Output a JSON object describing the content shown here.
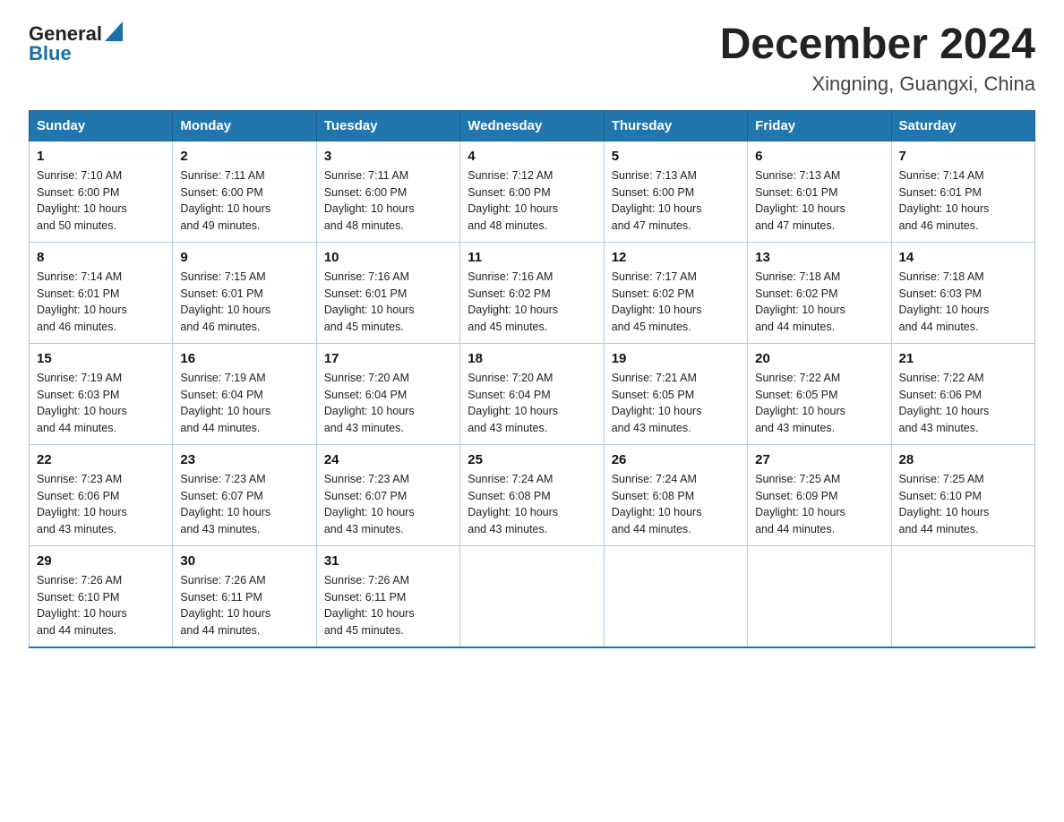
{
  "logo": {
    "general": "General",
    "triangle": "▶",
    "blue": "Blue"
  },
  "title": "December 2024",
  "location": "Xingning, Guangxi, China",
  "weekdays": [
    "Sunday",
    "Monday",
    "Tuesday",
    "Wednesday",
    "Thursday",
    "Friday",
    "Saturday"
  ],
  "weeks": [
    [
      {
        "day": "1",
        "sunrise": "7:10 AM",
        "sunset": "6:00 PM",
        "daylight": "10 hours and 50 minutes."
      },
      {
        "day": "2",
        "sunrise": "7:11 AM",
        "sunset": "6:00 PM",
        "daylight": "10 hours and 49 minutes."
      },
      {
        "day": "3",
        "sunrise": "7:11 AM",
        "sunset": "6:00 PM",
        "daylight": "10 hours and 48 minutes."
      },
      {
        "day": "4",
        "sunrise": "7:12 AM",
        "sunset": "6:00 PM",
        "daylight": "10 hours and 48 minutes."
      },
      {
        "day": "5",
        "sunrise": "7:13 AM",
        "sunset": "6:00 PM",
        "daylight": "10 hours and 47 minutes."
      },
      {
        "day": "6",
        "sunrise": "7:13 AM",
        "sunset": "6:01 PM",
        "daylight": "10 hours and 47 minutes."
      },
      {
        "day": "7",
        "sunrise": "7:14 AM",
        "sunset": "6:01 PM",
        "daylight": "10 hours and 46 minutes."
      }
    ],
    [
      {
        "day": "8",
        "sunrise": "7:14 AM",
        "sunset": "6:01 PM",
        "daylight": "10 hours and 46 minutes."
      },
      {
        "day": "9",
        "sunrise": "7:15 AM",
        "sunset": "6:01 PM",
        "daylight": "10 hours and 46 minutes."
      },
      {
        "day": "10",
        "sunrise": "7:16 AM",
        "sunset": "6:01 PM",
        "daylight": "10 hours and 45 minutes."
      },
      {
        "day": "11",
        "sunrise": "7:16 AM",
        "sunset": "6:02 PM",
        "daylight": "10 hours and 45 minutes."
      },
      {
        "day": "12",
        "sunrise": "7:17 AM",
        "sunset": "6:02 PM",
        "daylight": "10 hours and 45 minutes."
      },
      {
        "day": "13",
        "sunrise": "7:18 AM",
        "sunset": "6:02 PM",
        "daylight": "10 hours and 44 minutes."
      },
      {
        "day": "14",
        "sunrise": "7:18 AM",
        "sunset": "6:03 PM",
        "daylight": "10 hours and 44 minutes."
      }
    ],
    [
      {
        "day": "15",
        "sunrise": "7:19 AM",
        "sunset": "6:03 PM",
        "daylight": "10 hours and 44 minutes."
      },
      {
        "day": "16",
        "sunrise": "7:19 AM",
        "sunset": "6:04 PM",
        "daylight": "10 hours and 44 minutes."
      },
      {
        "day": "17",
        "sunrise": "7:20 AM",
        "sunset": "6:04 PM",
        "daylight": "10 hours and 43 minutes."
      },
      {
        "day": "18",
        "sunrise": "7:20 AM",
        "sunset": "6:04 PM",
        "daylight": "10 hours and 43 minutes."
      },
      {
        "day": "19",
        "sunrise": "7:21 AM",
        "sunset": "6:05 PM",
        "daylight": "10 hours and 43 minutes."
      },
      {
        "day": "20",
        "sunrise": "7:22 AM",
        "sunset": "6:05 PM",
        "daylight": "10 hours and 43 minutes."
      },
      {
        "day": "21",
        "sunrise": "7:22 AM",
        "sunset": "6:06 PM",
        "daylight": "10 hours and 43 minutes."
      }
    ],
    [
      {
        "day": "22",
        "sunrise": "7:23 AM",
        "sunset": "6:06 PM",
        "daylight": "10 hours and 43 minutes."
      },
      {
        "day": "23",
        "sunrise": "7:23 AM",
        "sunset": "6:07 PM",
        "daylight": "10 hours and 43 minutes."
      },
      {
        "day": "24",
        "sunrise": "7:23 AM",
        "sunset": "6:07 PM",
        "daylight": "10 hours and 43 minutes."
      },
      {
        "day": "25",
        "sunrise": "7:24 AM",
        "sunset": "6:08 PM",
        "daylight": "10 hours and 43 minutes."
      },
      {
        "day": "26",
        "sunrise": "7:24 AM",
        "sunset": "6:08 PM",
        "daylight": "10 hours and 44 minutes."
      },
      {
        "day": "27",
        "sunrise": "7:25 AM",
        "sunset": "6:09 PM",
        "daylight": "10 hours and 44 minutes."
      },
      {
        "day": "28",
        "sunrise": "7:25 AM",
        "sunset": "6:10 PM",
        "daylight": "10 hours and 44 minutes."
      }
    ],
    [
      {
        "day": "29",
        "sunrise": "7:26 AM",
        "sunset": "6:10 PM",
        "daylight": "10 hours and 44 minutes."
      },
      {
        "day": "30",
        "sunrise": "7:26 AM",
        "sunset": "6:11 PM",
        "daylight": "10 hours and 44 minutes."
      },
      {
        "day": "31",
        "sunrise": "7:26 AM",
        "sunset": "6:11 PM",
        "daylight": "10 hours and 45 minutes."
      },
      null,
      null,
      null,
      null
    ]
  ],
  "labels": {
    "sunrise_prefix": "Sunrise: ",
    "sunset_prefix": "Sunset: ",
    "daylight_prefix": "Daylight: "
  }
}
